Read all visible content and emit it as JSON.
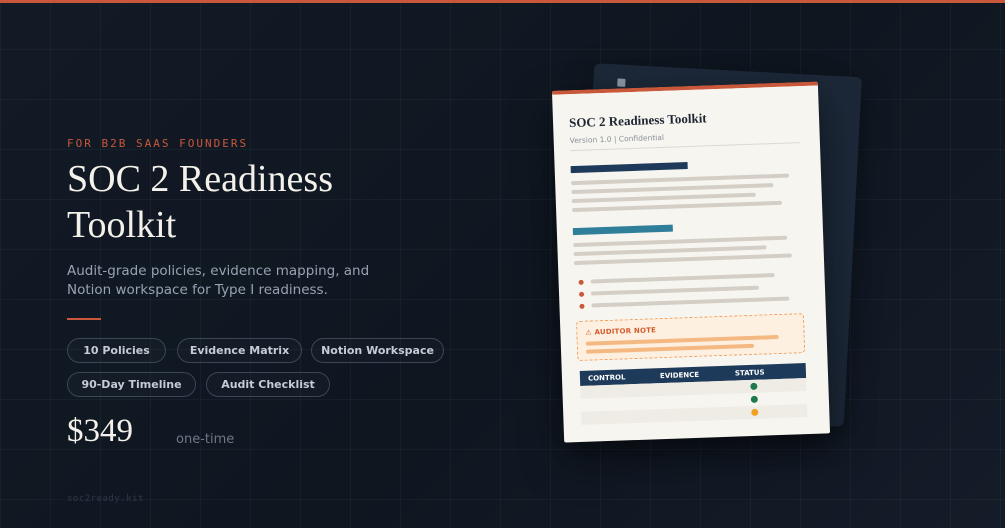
{
  "hero": {
    "eyebrow": "FOR B2B SAAS FOUNDERS",
    "title": "SOC 2 Readiness Toolkit",
    "description": "Audit-grade policies, evidence mapping, and Notion workspace for Type I readiness."
  },
  "features": [
    "10 Policies",
    "Evidence Matrix",
    "Notion Workspace",
    "90-Day Timeline",
    "Audit Checklist"
  ],
  "pricing": {
    "price": "$349",
    "note": "one-time"
  },
  "footer": {
    "url": "soc2ready.kit"
  },
  "preview": {
    "title": "SOC 2 Readiness Toolkit",
    "subtitle": "Version 1.0 | Confidential",
    "note_label": "⚠ AUDITOR NOTE",
    "table_headers": [
      "CONTROL",
      "EVIDENCE",
      "STATUS"
    ],
    "status_colors": [
      "#1e7a4c",
      "#1e7a4c",
      "#f0a020"
    ]
  },
  "colors": {
    "accent": "#c9583a",
    "navy": "#1e3a5a",
    "teal": "#2f7f9a",
    "background": "#121a26"
  }
}
